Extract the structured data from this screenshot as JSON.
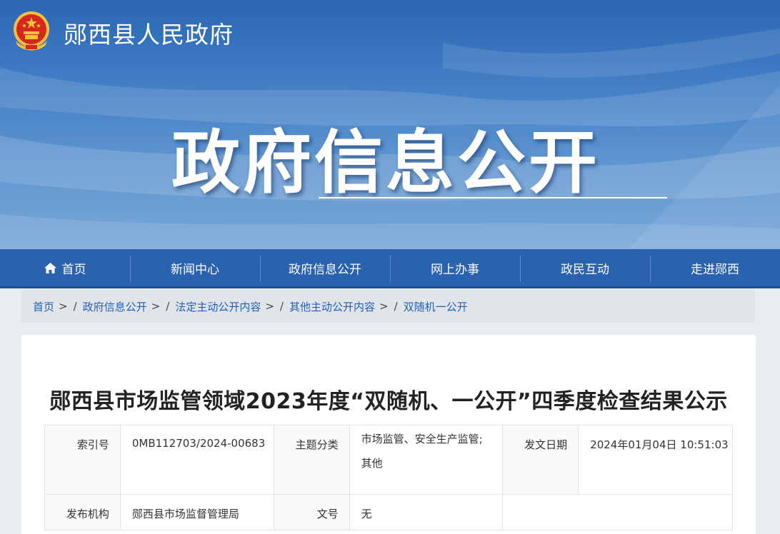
{
  "header": {
    "site_name": "郧西县人民政府",
    "banner_title": "政府信息公开",
    "emblem": "national-emblem-icon"
  },
  "nav": {
    "items": [
      {
        "label": "首页",
        "icon": "home-icon"
      },
      {
        "label": "新闻中心"
      },
      {
        "label": "政府信息公开"
      },
      {
        "label": "网上办事"
      },
      {
        "label": "政民互动"
      },
      {
        "label": "走进郧西"
      }
    ]
  },
  "breadcrumb": {
    "items": [
      "首页",
      "政府信息公开",
      "法定主动公开内容",
      "其他主动公开内容",
      "双随机一公开"
    ],
    "separator": ">"
  },
  "article": {
    "title": "郧西县市场监管领域2023年度“双随机、一公开”四季度检查结果公示",
    "meta": {
      "index_label": "索引号",
      "index_value": "0MB112703/2024-00683",
      "topic_label": "主题分类",
      "topic_value_line1": "市场监管、安全生产监管;",
      "topic_value_line2": "其他",
      "date_label": "发文日期",
      "date_value": "2024年01月04日 10:51:03",
      "publisher_label": "发布机构",
      "publisher_value": "郧西县市场监督管理局",
      "docno_label": "文号",
      "docno_value": "无"
    }
  },
  "colors": {
    "nav_bg": "#2a62ae",
    "link": "#1f5fb8",
    "banner_top": "#2c66b3",
    "banner_bottom": "#7aa8d8"
  }
}
